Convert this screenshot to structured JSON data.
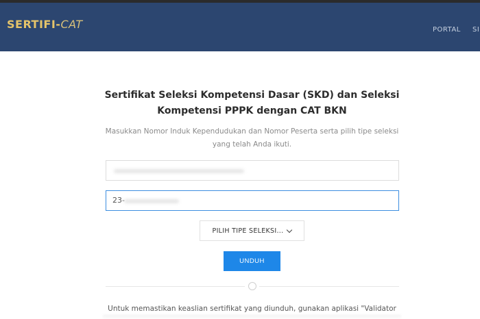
{
  "header": {
    "logo_text_left": "SERTIFI-",
    "logo_text_right": "CAT",
    "nav_portal": "PORTAL",
    "nav_sim": "SI",
    "background_color": "#2c4670",
    "logo_color": "#e5c46a"
  },
  "form": {
    "title": "Sertifikat Seleksi Kompetensi Dasar (SKD) dan Seleksi Kompetensi PPPK dengan CAT BKN",
    "subtitle": "Masukkan Nomor Induk Kependudukan dan Nomor Peserta serta pilih tipe seleksi yang telah Anda ikuti.",
    "nik_value": "",
    "peserta_value": "23-",
    "select_label": "PILIH TIPE SELEKSI...",
    "submit_label": "UNDUH",
    "accent_color": "#1e87e8"
  },
  "footer": {
    "text": "Untuk memastikan keaslian sertifikat yang diunduh, gunakan aplikasi \"Validator"
  }
}
